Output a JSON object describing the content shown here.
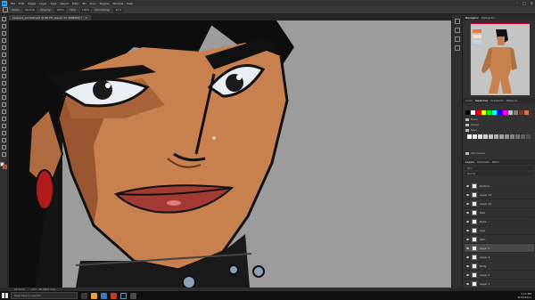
{
  "app": {
    "logo": "Ps",
    "menu": [
      "File",
      "Edit",
      "Image",
      "Layer",
      "Type",
      "Select",
      "Filter",
      "3D",
      "View",
      "Plugins",
      "Window",
      "Help"
    ],
    "window_controls": [
      "–",
      "□",
      "✕"
    ]
  },
  "options_bar": {
    "items": [
      "Mode:",
      "Normal",
      "Opacity:",
      "100%",
      "Flow:",
      "100%",
      "Smoothing:",
      "10%"
    ]
  },
  "document_tab": {
    "title": "Leopard_portrait.psd @ 66.7% (Layer 12, RGB/8#) *",
    "close": "✕"
  },
  "status_bar": {
    "zoom": "66.67%",
    "doc_info": "Doc: 48.0M/1.23G"
  },
  "panels": {
    "navigator_tabs": [
      "Navigator",
      "Histogram"
    ],
    "swatches_tabs": [
      "Color",
      "Swatches",
      "Gradients",
      "Patterns"
    ],
    "swatch_groups": [
      "Basic",
      "Pastel",
      "Dark",
      "Skin tones"
    ],
    "swatch_colors": [
      "#000000",
      "#ffffff",
      "#ff0000",
      "#ffff00",
      "#00ff00",
      "#00ffff",
      "#0000ff",
      "#ff00ff",
      "#c0c0c0",
      "#808080",
      "#7a3b2e",
      "#c6794b"
    ],
    "gray_colors": [
      "#ffffff",
      "#f0f0f0",
      "#e0e0e0",
      "#d0d0d0",
      "#c0c0c0",
      "#b0b0b0",
      "#a0a0a0",
      "#909090",
      "#808080",
      "#707070",
      "#606060",
      "#505050"
    ],
    "layers_tabs": [
      "Layers",
      "Channels",
      "Paths"
    ],
    "layers_options": [
      "Kind",
      "Normal",
      "Lock:"
    ],
    "layers": [
      {
        "name": "Outline"
      },
      {
        "name": "Layer 13"
      },
      {
        "name": "Layer 12"
      },
      {
        "name": "Hair"
      },
      {
        "name": "Eyes"
      },
      {
        "name": "Lips"
      },
      {
        "name": "Skin"
      },
      {
        "name": "Layer 5"
      },
      {
        "name": "Layer 4"
      },
      {
        "name": "Body"
      },
      {
        "name": "Layer 2"
      },
      {
        "name": "Layer 1"
      }
    ],
    "selected_layer": 7
  },
  "taskbar": {
    "search_placeholder": "Type here to search",
    "time": "3:14 PM",
    "date": "8/16/2021"
  },
  "colors": {
    "canvas_gray": "#9c9c9c",
    "skin": "#c9804f",
    "lip_red": "#a33a33",
    "earring_red": "#b01a1a"
  }
}
